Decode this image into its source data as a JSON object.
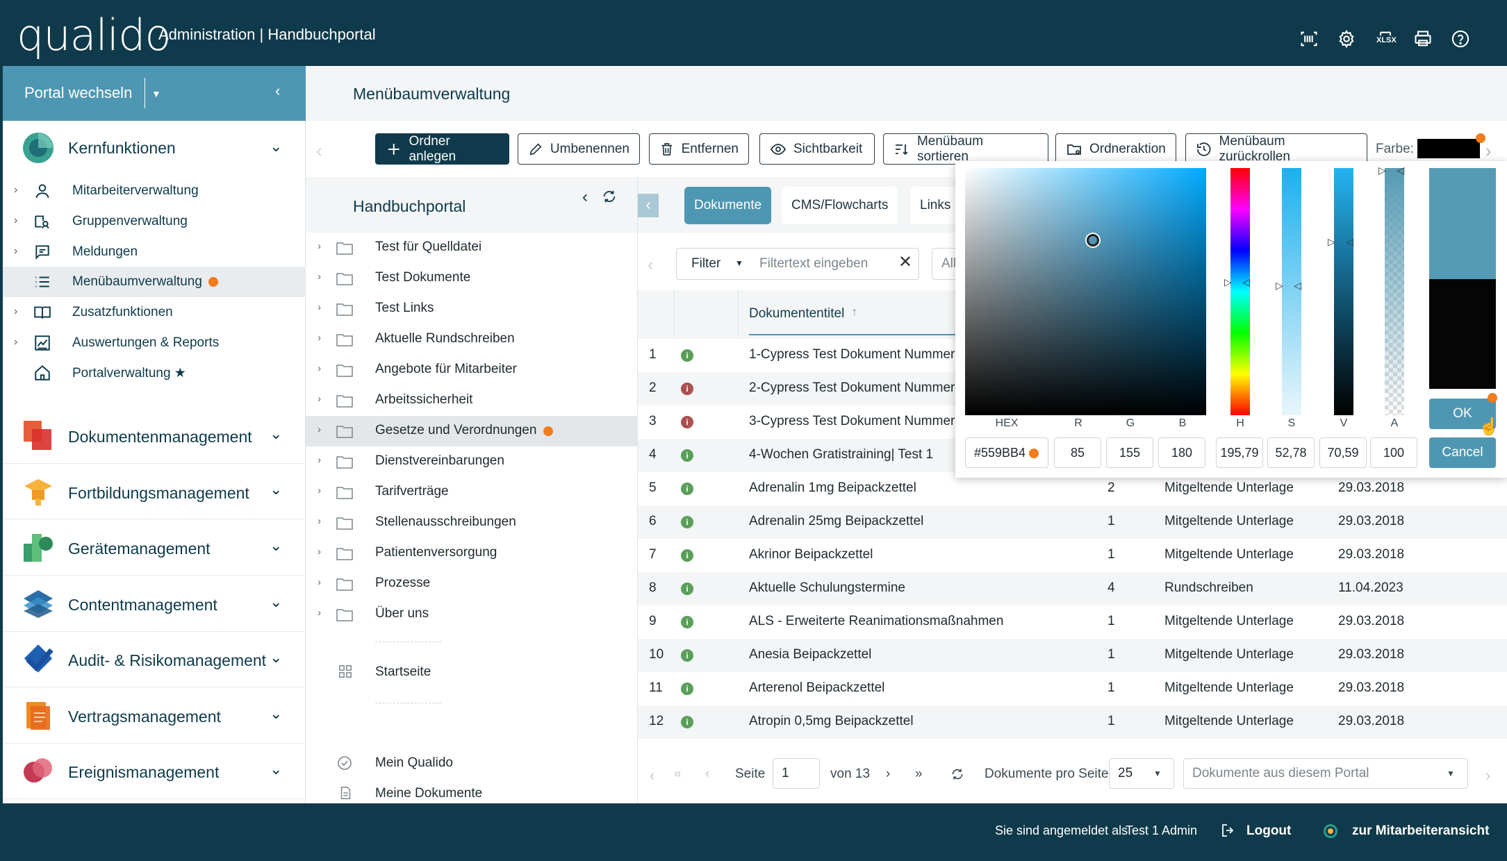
{
  "header": {
    "logo": "qualido",
    "title": "Administration | Handbuchportal",
    "icons": [
      "barcode-scan-icon",
      "gear-icon",
      "xlsx-icon",
      "printer-icon",
      "help-icon"
    ],
    "xlsx_label": "XLSX"
  },
  "sidebar": {
    "portal_switch": "Portal wechseln",
    "kern": "Kernfunktionen",
    "sub_items": [
      {
        "label": "Mitarbeiterverwaltung",
        "icon": "user-icon"
      },
      {
        "label": "Gruppenverwaltung",
        "icon": "group-icon"
      },
      {
        "label": "Meldungen",
        "icon": "message-icon"
      },
      {
        "label": "Menübaumverwaltung",
        "icon": "list-icon"
      },
      {
        "label": "Zusatzfunktionen",
        "icon": "book-icon"
      },
      {
        "label": "Auswertungen & Reports",
        "icon": "chart-icon"
      },
      {
        "label": "Portalverwaltung ★",
        "icon": "home-icon"
      }
    ],
    "groups": [
      "Dokumentenmanagement",
      "Fortbildungsmanagement",
      "Gerätemanagement",
      "Contentmanagement",
      "Audit- & Risikomanagement",
      "Vertragsmanagement",
      "Ereignismanagement"
    ]
  },
  "main": {
    "page_title": "Menübaumverwaltung",
    "toolbar": {
      "create_folder": "Ordner anlegen",
      "rename": "Umbenennen",
      "remove": "Entfernen",
      "visibility": "Sichtbarkeit",
      "sort": "Menübaum sortieren",
      "folder_action": "Ordneraktion",
      "rollback": "Menübaum zurückrollen",
      "color_label": "Farbe:"
    },
    "tree": {
      "title": "Handbuchportal",
      "folders": [
        "Test für Quelldatei",
        "Test Dokumente",
        "Test Links",
        "Aktuelle Rundschreiben",
        "Angebote für Mitarbeiter",
        "Arbeitssicherheit",
        "Gesetze und Verordnungen",
        "Dienstvereinbarungen",
        "Tarifverträge",
        "Stellenausschreibungen",
        "Patientenversorgung",
        "Prozesse",
        "Über uns"
      ],
      "startseite": "Startseite",
      "mein_qualido": "Mein Qualido",
      "meine_dokumente": "Meine Dokumente"
    },
    "tabs": [
      "Dokumente",
      "CMS/Flowcharts",
      "Links"
    ],
    "filter": {
      "label": "Filter",
      "placeholder": "Filtertext eingeben",
      "all": "All"
    },
    "table": {
      "col_title": "Dokumententitel",
      "rows": [
        {
          "n": "1",
          "title": "1-Cypress Test Dokument Nummer",
          "count": "",
          "type": "",
          "date": "",
          "status": "green"
        },
        {
          "n": "2",
          "title": "2-Cypress Test Dokument Nummer",
          "count": "",
          "type": "",
          "date": "",
          "status": "red"
        },
        {
          "n": "3",
          "title": "3-Cypress Test Dokument Nummer",
          "count": "",
          "type": "",
          "date": "",
          "status": "red"
        },
        {
          "n": "4",
          "title": "4-Wochen Gratistraining| Test 1",
          "count": "",
          "type": "",
          "date": "",
          "status": "green"
        },
        {
          "n": "5",
          "title": "Adrenalin 1mg Beipackzettel",
          "count": "2",
          "type": "Mitgeltende Unterlage",
          "date": "29.03.2018",
          "status": "green"
        },
        {
          "n": "6",
          "title": "Adrenalin 25mg Beipackzettel",
          "count": "1",
          "type": "Mitgeltende Unterlage",
          "date": "29.03.2018",
          "status": "green"
        },
        {
          "n": "7",
          "title": "Akrinor Beipackzettel",
          "count": "1",
          "type": "Mitgeltende Unterlage",
          "date": "29.03.2018",
          "status": "green"
        },
        {
          "n": "8",
          "title": "Aktuelle Schulungstermine",
          "count": "4",
          "type": "Rundschreiben",
          "date": "11.04.2023",
          "status": "green"
        },
        {
          "n": "9",
          "title": "ALS - Erweiterte Reanimationsmaßnahmen",
          "count": "1",
          "type": "Mitgeltende Unterlage",
          "date": "29.03.2018",
          "status": "green"
        },
        {
          "n": "10",
          "title": "Anesia Beipackzettel",
          "count": "1",
          "type": "Mitgeltende Unterlage",
          "date": "29.03.2018",
          "status": "green"
        },
        {
          "n": "11",
          "title": "Arterenol Beipackzettel",
          "count": "1",
          "type": "Mitgeltende Unterlage",
          "date": "29.03.2018",
          "status": "green"
        },
        {
          "n": "12",
          "title": "Atropin 0,5mg Beipackzettel",
          "count": "1",
          "type": "Mitgeltende Unterlage",
          "date": "29.03.2018",
          "status": "green"
        }
      ]
    },
    "pager": {
      "page_label": "Seite",
      "page": "1",
      "of": "von 13",
      "per_page_label": "Dokumente pro Seite:",
      "per_page": "25",
      "scope": "Dokumente aus diesem Portal"
    }
  },
  "color_picker": {
    "labels": [
      "HEX",
      "R",
      "G",
      "B",
      "H",
      "S",
      "V",
      "A"
    ],
    "values": [
      "#559BB4",
      "85",
      "155",
      "180",
      "195,79",
      "52,78",
      "70,59",
      "100"
    ],
    "ok": "OK",
    "cancel": "Cancel",
    "selected_color": "#559BB4"
  },
  "footer": {
    "logged_in_prefix": "Sie sind angemeldet als",
    "user": "Test 1 Admin",
    "logout": "Logout",
    "employee_view": "zur Mitarbeiteransicht"
  },
  "colors": {
    "brand_dark": "#0F3A4B",
    "brand_accent": "#4E97B3",
    "status_orange": "#F07C1D",
    "status_green": "#5A9E5A",
    "status_red": "#A9514F"
  }
}
